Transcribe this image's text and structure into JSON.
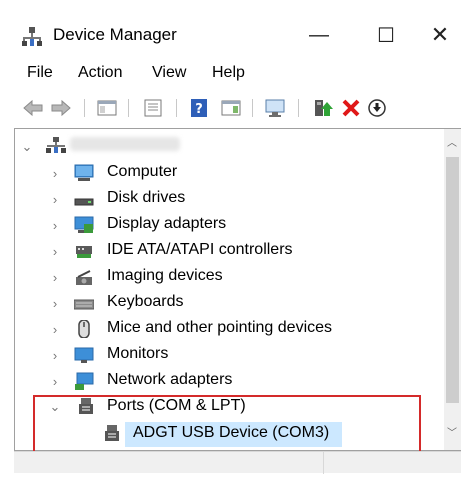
{
  "window": {
    "title": "Device Manager",
    "minimize_glyph": "—",
    "maximize_glyph": "☐",
    "close_glyph": "✕"
  },
  "menu": {
    "file": "File",
    "action": "Action",
    "view": "View",
    "help": "Help"
  },
  "toolbar": {
    "icons": [
      "back-arrow-icon",
      "forward-arrow-icon",
      "show-hide-console-tree-icon",
      "properties-icon",
      "help-icon",
      "action-pane-icon",
      "scan-hardware-icon",
      "enable-device-icon",
      "uninstall-device-icon",
      "update-driver-icon"
    ]
  },
  "tree": {
    "root_label": "",
    "categories": [
      {
        "label": "Computer",
        "icon": "computer-icon"
      },
      {
        "label": "Disk drives",
        "icon": "disk-drive-icon"
      },
      {
        "label": "Display adapters",
        "icon": "display-adapter-icon"
      },
      {
        "label": "IDE ATA/ATAPI controllers",
        "icon": "ide-controller-icon"
      },
      {
        "label": "Imaging devices",
        "icon": "camera-icon"
      },
      {
        "label": "Keyboards",
        "icon": "keyboard-icon"
      },
      {
        "label": "Mice and other pointing devices",
        "icon": "mouse-icon"
      },
      {
        "label": "Monitors",
        "icon": "monitor-icon"
      },
      {
        "label": "Network adapters",
        "icon": "network-adapter-icon"
      },
      {
        "label": "Ports (COM & LPT)",
        "icon": "port-icon"
      }
    ],
    "selected_child": {
      "label": "ADGT USB Device (COM3)",
      "icon": "port-icon"
    }
  },
  "colors": {
    "highlight_border": "#d42a2a",
    "selection": "#cce8ff"
  }
}
